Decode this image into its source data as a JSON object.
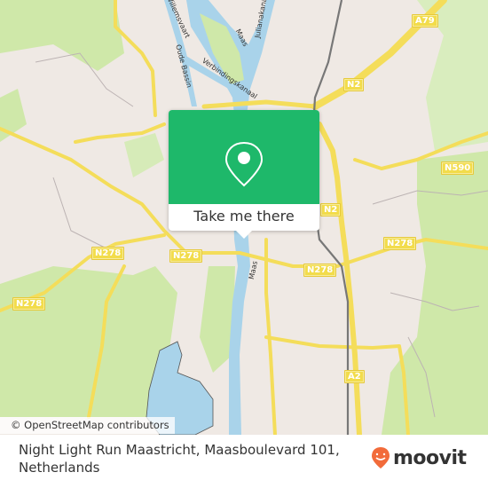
{
  "map": {
    "road_shields": [
      {
        "label": "A79",
        "id": "a79"
      },
      {
        "label": "N2",
        "id": "n2-north"
      },
      {
        "label": "N590",
        "id": "n590"
      },
      {
        "label": "N2",
        "id": "n2-center"
      },
      {
        "label": "N278",
        "id": "n278-west"
      },
      {
        "label": "N278",
        "id": "n278-center"
      },
      {
        "label": "N278",
        "id": "n278-east"
      },
      {
        "label": "N278",
        "id": "n278-far-east"
      },
      {
        "label": "N278",
        "id": "n278-southwest"
      },
      {
        "label": "A2",
        "id": "a2"
      }
    ],
    "water_labels": [
      {
        "label": "Maas",
        "id": "maas-north"
      },
      {
        "label": "Julianakanaal",
        "id": "julianakanaal"
      },
      {
        "label": "Oude Bassin",
        "id": "oude-bassin"
      },
      {
        "label": "Verbindingskanaal",
        "id": "verbindingskanaal"
      },
      {
        "label": "Zuid-Willemsvaart",
        "id": "zuid-willemsvaart"
      },
      {
        "label": "Maas",
        "id": "maas-south"
      }
    ],
    "colors": {
      "land": "#efe9e4",
      "park": "#cfe8a9",
      "water": "#a9d3ea",
      "road_major": "#f4dd5a",
      "railway": "#777777"
    }
  },
  "popup": {
    "cta_label": "Take me there",
    "accent_color": "#1eb86a",
    "icon": "location-pin-icon"
  },
  "attribution": "© OpenStreetMap contributors",
  "footer": {
    "address": "Night Light Run Maastricht, Maasboulevard 101, Netherlands",
    "brand": "moovit",
    "brand_color": "#f26b3a"
  }
}
